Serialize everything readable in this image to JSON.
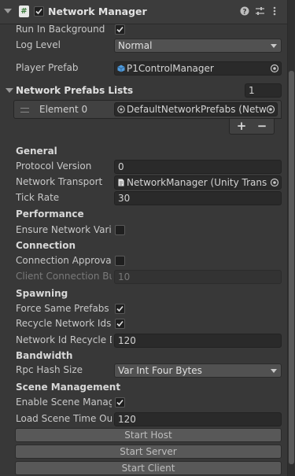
{
  "header": {
    "title": "Network Manager",
    "enabled": true,
    "icons": [
      "script-icon",
      "help-icon",
      "settings-icon",
      "more-icon"
    ]
  },
  "fields": {
    "run_in_background": {
      "label": "Run In Background",
      "checked": true
    },
    "log_level": {
      "label": "Log Level",
      "value": "Normal"
    },
    "player_prefab": {
      "label": "Player Prefab",
      "value": "P1ControlManager"
    }
  },
  "prefab_lists": {
    "title": "Network Prefabs Lists",
    "count": "1",
    "element_label": "Element 0",
    "element_value": "DefaultNetworkPrefabs (Netwo",
    "add": "+",
    "remove": "−"
  },
  "general": {
    "heading": "General",
    "protocol_version": {
      "label": "Protocol Version",
      "value": "0"
    },
    "network_transport": {
      "label": "Network Transport",
      "value": "NetworkManager (Unity Transpo"
    },
    "tick_rate": {
      "label": "Tick Rate",
      "value": "30"
    }
  },
  "performance": {
    "heading": "Performance",
    "ensure_network_variable": {
      "label": "Ensure Network Varia",
      "checked": false
    }
  },
  "connection": {
    "heading": "Connection",
    "connection_approval": {
      "label": "Connection Approval",
      "checked": false
    },
    "client_connection_buffer": {
      "label": "Client Connection Buf",
      "value": "10"
    }
  },
  "spawning": {
    "heading": "Spawning",
    "force_same_prefabs": {
      "label": "Force Same Prefabs",
      "checked": true
    },
    "recycle_network_ids": {
      "label": "Recycle Network Ids",
      "checked": true
    },
    "recycle_delay": {
      "label": "Network Id Recycle D",
      "value": "120"
    }
  },
  "bandwidth": {
    "heading": "Bandwidth",
    "rpc_hash_size": {
      "label": "Rpc Hash Size",
      "value": "Var Int Four Bytes"
    }
  },
  "scene_management": {
    "heading": "Scene Management",
    "enable_scene_management": {
      "label": "Enable Scene Manage",
      "checked": true
    },
    "load_scene_timeout": {
      "label": "Load Scene Time Out",
      "value": "120"
    }
  },
  "buttons": {
    "start_host": "Start Host",
    "start_server": "Start Server",
    "start_client": "Start Client"
  },
  "colors": {
    "background": "#383838",
    "field": "#2a2a2a",
    "button": "#585858",
    "text": "#c8c8c8"
  }
}
